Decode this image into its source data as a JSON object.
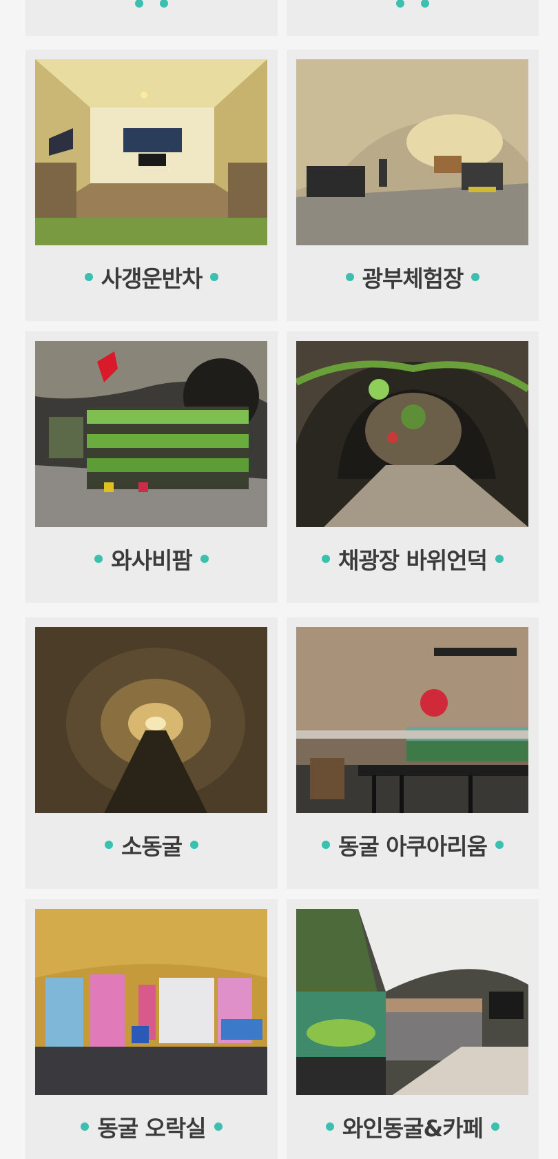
{
  "colors": {
    "accent_dot": "#3bbfae",
    "card_bg": "#ececec",
    "page_bg": "#f5f5f5",
    "caption_text": "#3b3b3b"
  },
  "top_row": {
    "left_caption": "",
    "right_caption": ""
  },
  "cards": [
    {
      "caption": "사갱운반차"
    },
    {
      "caption": "광부체험장"
    },
    {
      "caption": "와사비팜"
    },
    {
      "caption": "채광장 바위언덕"
    },
    {
      "caption": "소동굴"
    },
    {
      "caption": "동굴 아쿠아리움"
    },
    {
      "caption": "동굴 오락실"
    },
    {
      "caption": "와인동굴&카페"
    }
  ]
}
